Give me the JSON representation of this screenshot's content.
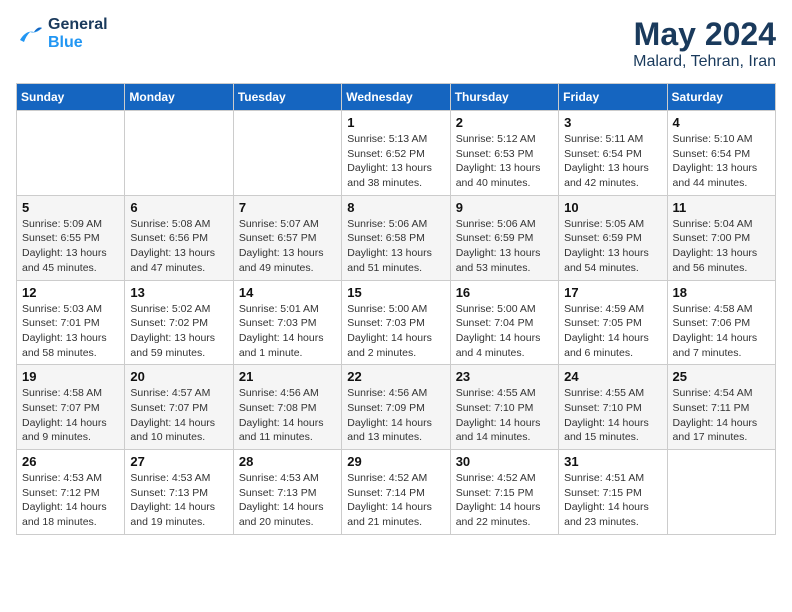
{
  "logo": {
    "line1": "General",
    "line2": "Blue"
  },
  "title": {
    "month_year": "May 2024",
    "location": "Malard, Tehran, Iran"
  },
  "weekdays": [
    "Sunday",
    "Monday",
    "Tuesday",
    "Wednesday",
    "Thursday",
    "Friday",
    "Saturday"
  ],
  "weeks": [
    [
      {
        "day": "",
        "info": ""
      },
      {
        "day": "",
        "info": ""
      },
      {
        "day": "",
        "info": ""
      },
      {
        "day": "1",
        "info": "Sunrise: 5:13 AM\nSunset: 6:52 PM\nDaylight: 13 hours\nand 38 minutes."
      },
      {
        "day": "2",
        "info": "Sunrise: 5:12 AM\nSunset: 6:53 PM\nDaylight: 13 hours\nand 40 minutes."
      },
      {
        "day": "3",
        "info": "Sunrise: 5:11 AM\nSunset: 6:54 PM\nDaylight: 13 hours\nand 42 minutes."
      },
      {
        "day": "4",
        "info": "Sunrise: 5:10 AM\nSunset: 6:54 PM\nDaylight: 13 hours\nand 44 minutes."
      }
    ],
    [
      {
        "day": "5",
        "info": "Sunrise: 5:09 AM\nSunset: 6:55 PM\nDaylight: 13 hours\nand 45 minutes."
      },
      {
        "day": "6",
        "info": "Sunrise: 5:08 AM\nSunset: 6:56 PM\nDaylight: 13 hours\nand 47 minutes."
      },
      {
        "day": "7",
        "info": "Sunrise: 5:07 AM\nSunset: 6:57 PM\nDaylight: 13 hours\nand 49 minutes."
      },
      {
        "day": "8",
        "info": "Sunrise: 5:06 AM\nSunset: 6:58 PM\nDaylight: 13 hours\nand 51 minutes."
      },
      {
        "day": "9",
        "info": "Sunrise: 5:06 AM\nSunset: 6:59 PM\nDaylight: 13 hours\nand 53 minutes."
      },
      {
        "day": "10",
        "info": "Sunrise: 5:05 AM\nSunset: 6:59 PM\nDaylight: 13 hours\nand 54 minutes."
      },
      {
        "day": "11",
        "info": "Sunrise: 5:04 AM\nSunset: 7:00 PM\nDaylight: 13 hours\nand 56 minutes."
      }
    ],
    [
      {
        "day": "12",
        "info": "Sunrise: 5:03 AM\nSunset: 7:01 PM\nDaylight: 13 hours\nand 58 minutes."
      },
      {
        "day": "13",
        "info": "Sunrise: 5:02 AM\nSunset: 7:02 PM\nDaylight: 13 hours\nand 59 minutes."
      },
      {
        "day": "14",
        "info": "Sunrise: 5:01 AM\nSunset: 7:03 PM\nDaylight: 14 hours\nand 1 minute."
      },
      {
        "day": "15",
        "info": "Sunrise: 5:00 AM\nSunset: 7:03 PM\nDaylight: 14 hours\nand 2 minutes."
      },
      {
        "day": "16",
        "info": "Sunrise: 5:00 AM\nSunset: 7:04 PM\nDaylight: 14 hours\nand 4 minutes."
      },
      {
        "day": "17",
        "info": "Sunrise: 4:59 AM\nSunset: 7:05 PM\nDaylight: 14 hours\nand 6 minutes."
      },
      {
        "day": "18",
        "info": "Sunrise: 4:58 AM\nSunset: 7:06 PM\nDaylight: 14 hours\nand 7 minutes."
      }
    ],
    [
      {
        "day": "19",
        "info": "Sunrise: 4:58 AM\nSunset: 7:07 PM\nDaylight: 14 hours\nand 9 minutes."
      },
      {
        "day": "20",
        "info": "Sunrise: 4:57 AM\nSunset: 7:07 PM\nDaylight: 14 hours\nand 10 minutes."
      },
      {
        "day": "21",
        "info": "Sunrise: 4:56 AM\nSunset: 7:08 PM\nDaylight: 14 hours\nand 11 minutes."
      },
      {
        "day": "22",
        "info": "Sunrise: 4:56 AM\nSunset: 7:09 PM\nDaylight: 14 hours\nand 13 minutes."
      },
      {
        "day": "23",
        "info": "Sunrise: 4:55 AM\nSunset: 7:10 PM\nDaylight: 14 hours\nand 14 minutes."
      },
      {
        "day": "24",
        "info": "Sunrise: 4:55 AM\nSunset: 7:10 PM\nDaylight: 14 hours\nand 15 minutes."
      },
      {
        "day": "25",
        "info": "Sunrise: 4:54 AM\nSunset: 7:11 PM\nDaylight: 14 hours\nand 17 minutes."
      }
    ],
    [
      {
        "day": "26",
        "info": "Sunrise: 4:53 AM\nSunset: 7:12 PM\nDaylight: 14 hours\nand 18 minutes."
      },
      {
        "day": "27",
        "info": "Sunrise: 4:53 AM\nSunset: 7:13 PM\nDaylight: 14 hours\nand 19 minutes."
      },
      {
        "day": "28",
        "info": "Sunrise: 4:53 AM\nSunset: 7:13 PM\nDaylight: 14 hours\nand 20 minutes."
      },
      {
        "day": "29",
        "info": "Sunrise: 4:52 AM\nSunset: 7:14 PM\nDaylight: 14 hours\nand 21 minutes."
      },
      {
        "day": "30",
        "info": "Sunrise: 4:52 AM\nSunset: 7:15 PM\nDaylight: 14 hours\nand 22 minutes."
      },
      {
        "day": "31",
        "info": "Sunrise: 4:51 AM\nSunset: 7:15 PM\nDaylight: 14 hours\nand 23 minutes."
      },
      {
        "day": "",
        "info": ""
      }
    ]
  ]
}
